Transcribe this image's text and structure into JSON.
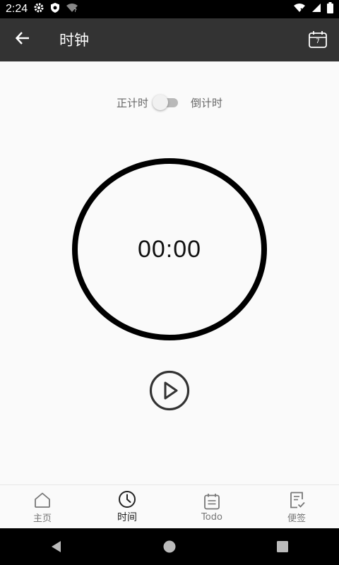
{
  "status_bar": {
    "time": "2:24"
  },
  "app_bar": {
    "title": "时钟"
  },
  "mode_toggle": {
    "left_label": "正计时",
    "right_label": "倒计时"
  },
  "timer": {
    "display": "00:00"
  },
  "bottom_nav": {
    "items": [
      {
        "label": "主页",
        "icon": "home-icon"
      },
      {
        "label": "时间",
        "icon": "clock-icon"
      },
      {
        "label": "Todo",
        "icon": "calendar-list-icon"
      },
      {
        "label": "便签",
        "icon": "note-check-icon"
      }
    ],
    "active_index": 1
  },
  "calendar_badge": {
    "day": "7"
  },
  "colors": {
    "app_bar": "#333333",
    "background": "#fafafa",
    "status_bar": "#000000"
  }
}
